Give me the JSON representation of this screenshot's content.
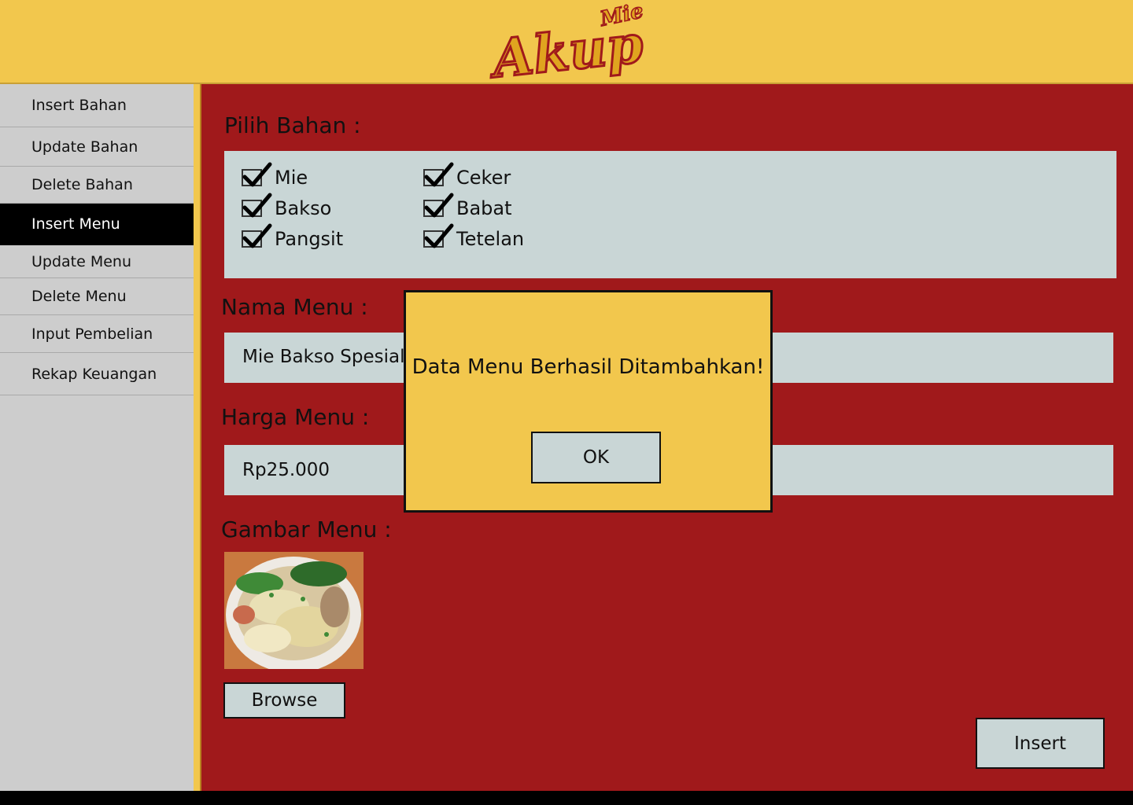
{
  "header": {
    "logo_small": "Mie",
    "logo_big": "Akup"
  },
  "sidebar": {
    "items": [
      {
        "label": "Insert Bahan"
      },
      {
        "label": "Update Bahan"
      },
      {
        "label": "Delete Bahan"
      },
      {
        "label": "Insert Menu",
        "active": true
      },
      {
        "label": "Update Menu"
      },
      {
        "label": "Delete Menu"
      },
      {
        "label": "Input Pembelian"
      },
      {
        "label": "Rekap Keuangan"
      }
    ]
  },
  "form": {
    "pilih_bahan_label": "Pilih Bahan :",
    "ingredients": [
      {
        "label": "Mie",
        "checked": true
      },
      {
        "label": "Bakso",
        "checked": true
      },
      {
        "label": "Pangsit",
        "checked": true
      },
      {
        "label": "Ceker",
        "checked": true
      },
      {
        "label": "Babat",
        "checked": true
      },
      {
        "label": "Tetelan",
        "checked": true
      }
    ],
    "nama_menu_label": "Nama Menu :",
    "nama_menu_value": "Mie Bakso Spesial",
    "harga_menu_label": "Harga Menu :",
    "harga_menu_value": "Rp25.000",
    "gambar_menu_label": "Gambar Menu :",
    "browse_label": "Browse",
    "insert_label": "Insert"
  },
  "dialog": {
    "message": "Data Menu Berhasil Ditambahkan!",
    "ok_label": "OK"
  },
  "colors": {
    "header": "#f2c74d",
    "main": "#a0191b",
    "sidebar": "#cdcdcd",
    "field": "#c9d6d6",
    "active_nav": "#000000"
  }
}
